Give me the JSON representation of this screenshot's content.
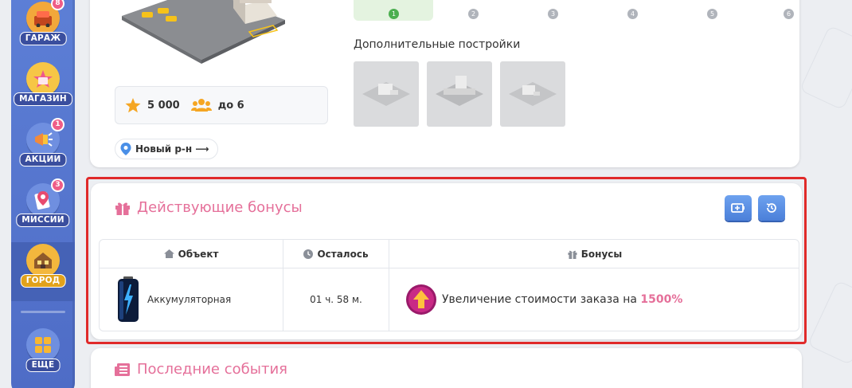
{
  "sidebar": {
    "items": [
      {
        "label": "ГАРАЖ",
        "badge": "8",
        "icon": "garage-icon"
      },
      {
        "label": "МАГАЗИН",
        "badge": "",
        "icon": "shop-icon"
      },
      {
        "label": "АКЦИИ",
        "badge": "1",
        "icon": "megaphone-icon"
      },
      {
        "label": "МИССИИ",
        "badge": "3",
        "icon": "missions-icon"
      },
      {
        "label": "ГОРОД",
        "badge": "",
        "icon": "city-icon",
        "active": true
      },
      {
        "label": "ЕЩЕ",
        "badge": "",
        "icon": "more-grid-icon"
      }
    ]
  },
  "city": {
    "stars": "5 000",
    "capacity": "до 6",
    "district_button": "Новый р-н ⟶",
    "levels": [
      "1",
      "2",
      "3",
      "4",
      "5",
      "6"
    ],
    "selected_level": "1",
    "extra_buildings_title": "Дополнительные постройки"
  },
  "bonuses": {
    "title": "Действующие бонусы",
    "columns": {
      "object": "Объект",
      "remaining": "Осталось",
      "bonuses": "Бонусы"
    },
    "rows": [
      {
        "object": "Аккумуляторная",
        "remaining": "01 ч. 58 м.",
        "bonus_text": "Увеличение стоимости заказа на",
        "bonus_value": "1500%"
      }
    ]
  },
  "events": {
    "title": "Последние события"
  },
  "colors": {
    "accent_pink": "#e5709a",
    "sidebar_blue": "#5d7fd6",
    "button_blue": "#4a7fd9",
    "highlight_red": "#e02a2a"
  }
}
